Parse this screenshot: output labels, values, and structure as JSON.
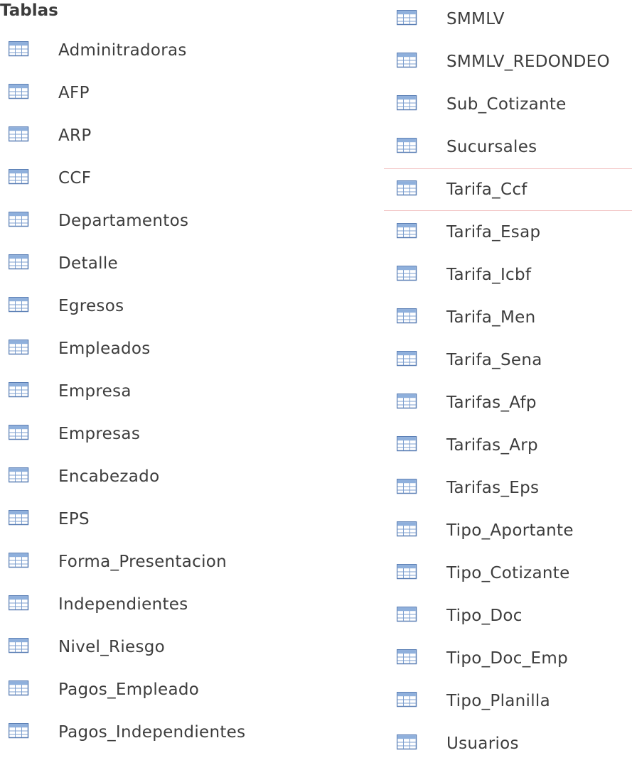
{
  "header": {
    "title": "Tablas"
  },
  "icon": "table-icon",
  "left_items": [
    "Adminitradoras",
    "AFP",
    "ARP",
    "CCF",
    "Departamentos",
    "Detalle",
    "Egresos",
    "Empleados",
    "Empresa",
    "Empresas",
    "Encabezado",
    "EPS",
    "Forma_Presentacion",
    "Independientes",
    "Nivel_Riesgo",
    "Pagos_Empleado",
    "Pagos_Independientes"
  ],
  "right_items": [
    "SMMLV",
    "SMMLV_REDONDEO",
    "Sub_Cotizante",
    "Sucursales",
    "Tarifa_Ccf",
    "Tarifa_Esap",
    "Tarifa_Icbf",
    "Tarifa_Men",
    "Tarifa_Sena",
    "Tarifas_Afp",
    "Tarifas_Arp",
    "Tarifas_Eps",
    "Tipo_Aportante",
    "Tipo_Cotizante",
    "Tipo_Doc",
    "Tipo_Doc_Emp",
    "Tipo_Planilla",
    "Usuarios"
  ],
  "selected_item": "Tarifa_Ccf",
  "colors": {
    "icon_border": "#5b7fb5",
    "icon_header": "#8fb0dc",
    "icon_body": "#ffffff",
    "icon_grid": "#7d9fcf",
    "selection_border": "#f2c4c4"
  }
}
